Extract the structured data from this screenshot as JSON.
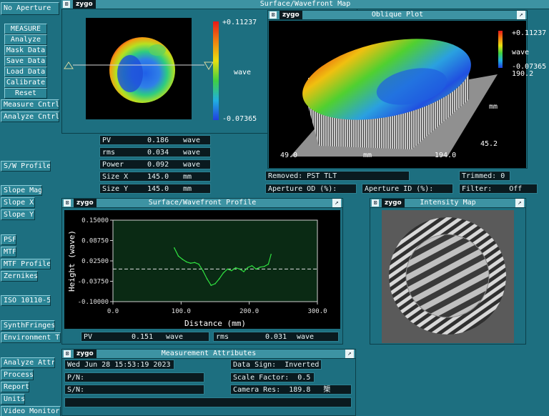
{
  "sidebar": {
    "aperture_label": "No Aperture",
    "buttons": [
      "MEASURE",
      "Analyze",
      "Mask Data",
      "Save Data",
      "Load Data",
      "Calibrate",
      "Reset"
    ],
    "controls": [
      "Measure Cntrl",
      "Analyze Cntrl"
    ],
    "sw_profile": "S/W Profile",
    "slope": [
      "Slope Mag",
      "Slope X",
      "Slope Y"
    ],
    "psf": [
      "PSF",
      "MTF",
      "MTF Profile",
      "Zernikes"
    ],
    "iso": "ISO 10110-5",
    "env": [
      "SynthFringes",
      "Environment Te"
    ],
    "bottom": [
      "Analyze Attr",
      "Process",
      "Report",
      "Units",
      "Video Monitor"
    ]
  },
  "map_window": {
    "title": "Surface/Wavefront Map",
    "logo": "zygo",
    "scale_max": "+0.11237",
    "scale_unit": "wave",
    "scale_min": "-0.07365",
    "stats": [
      {
        "label": "PV",
        "value": "0.186",
        "unit": "wave"
      },
      {
        "label": "rms",
        "value": "0.034",
        "unit": "wave"
      },
      {
        "label": "Power",
        "value": "0.092",
        "unit": "wave"
      },
      {
        "label": "Size X",
        "value": "145.0",
        "unit": "mm"
      },
      {
        "label": "Size Y",
        "value": "145.0",
        "unit": "mm"
      }
    ],
    "removed": "Removed: PST TLT",
    "trimmed_label": "Trimmed:",
    "trimmed_value": "0",
    "aperture_od": "Aperture OD (%):",
    "aperture_id": "Aperture ID (%):",
    "filter_label": "Filter:",
    "filter_value": "Off"
  },
  "oblique_window": {
    "title": "Oblique Plot",
    "logo": "zygo",
    "scale_max": "+0.11237",
    "scale_unit": "wave",
    "scale_min": "-0.07365",
    "y_max": "190.2",
    "y_unit": "mm",
    "y_min": "45.2",
    "x_min": "49.0",
    "x_unit": "mm",
    "x_max": "194.0"
  },
  "profile_window": {
    "title": "Surface/Wavefront Profile",
    "logo": "zygo",
    "pv_label": "PV",
    "pv_value": "0.151",
    "pv_unit": "wave",
    "rms_label": "rms",
    "rms_value": "0.031",
    "rms_unit": "wave"
  },
  "intensity_window": {
    "title": "Intensity Map",
    "logo": "zygo"
  },
  "attributes_window": {
    "title": "Measurement Attributes",
    "logo": "zygo",
    "date": "Wed Jun 28 15:53:19 2023",
    "pn": "P/N:",
    "sn": "S/N:",
    "data_sign": "Data Sign:  Inverted",
    "scale_factor": "Scale Factor:  0.5",
    "camera_res": "Camera Res:  189.8   榘"
  },
  "chart_data": {
    "type": "line",
    "title": "",
    "xlabel": "Distance (mm)",
    "ylabel": "Height (wave)",
    "xlim": [
      0,
      300
    ],
    "ylim": [
      -0.1,
      0.15
    ],
    "x_ticks": [
      "0.0",
      "100.0",
      "200.0",
      "300.0"
    ],
    "y_ticks": [
      "0.15000",
      "0.08750",
      "0.02500",
      "-0.03750",
      "-0.10000"
    ],
    "zero_line": 0,
    "grid": false,
    "series": [
      {
        "x": [
          90,
          96,
          102,
          108,
          114,
          120,
          126,
          132,
          138,
          144,
          150,
          156,
          162,
          168,
          174,
          180,
          186,
          192,
          198,
          204,
          210,
          216,
          222,
          228,
          232
        ],
        "y": [
          0.065,
          0.04,
          0.03,
          0.022,
          0.018,
          0.02,
          0.015,
          -0.005,
          -0.03,
          -0.05,
          -0.045,
          -0.03,
          -0.012,
          0.0,
          -0.005,
          0.004,
          0.0,
          -0.008,
          0.005,
          0.01,
          0.0,
          0.006,
          0.008,
          0.015,
          0.045
        ]
      }
    ]
  }
}
